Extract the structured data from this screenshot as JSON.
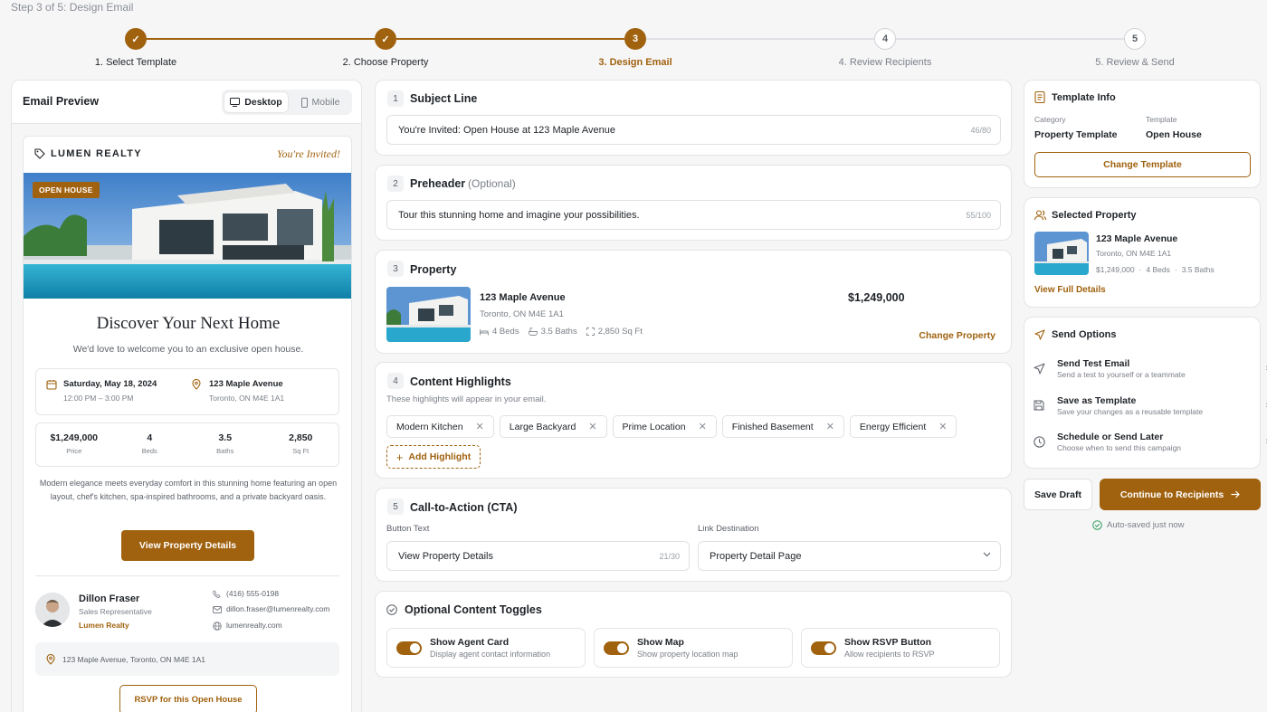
{
  "header": {
    "step_label": "Step 3 of 5: Design Email"
  },
  "stepper": [
    {
      "num": "1",
      "label": "1. Select Template",
      "state": "done"
    },
    {
      "num": "2",
      "label": "2. Choose Property",
      "state": "done"
    },
    {
      "num": "3",
      "label": "3. Design Email",
      "state": "current"
    },
    {
      "num": "4",
      "label": "4. Review Recipients",
      "state": "todo"
    },
    {
      "num": "5",
      "label": "5. Review & Send",
      "state": "todo"
    }
  ],
  "preview": {
    "title": "Email Preview",
    "desktop": "Desktop",
    "mobile": "Mobile",
    "brand": "LUMEN REALTY",
    "invited": "You're Invited!",
    "badge": "OPEN HOUSE",
    "headline": "Discover Your Next Home",
    "subhead": "We'd love to welcome you to an exclusive open house.",
    "date": "Saturday, May 18, 2024",
    "time": "12:00 PM – 3:00 PM",
    "address": "123 Maple Avenue",
    "city": "Toronto, ON M4E 1A1",
    "stats": [
      {
        "value": "$1,249,000",
        "label": "Price"
      },
      {
        "value": "4",
        "label": "Beds"
      },
      {
        "value": "3.5",
        "label": "Baths"
      },
      {
        "value": "2,850",
        "label": "Sq Ft"
      }
    ],
    "description": "Modern elegance meets everyday comfort in this stunning home featuring an open layout, chef's kitchen, spa-inspired bathrooms, and a private backyard oasis.",
    "cta": "View Property Details",
    "agent": {
      "name": "Dillon Fraser",
      "role": "Sales Representative",
      "company": "Lumen Realty",
      "phone": "(416) 555-0198",
      "email": "dillon.fraser@lumenrealty.com",
      "web": "lumenrealty.com"
    },
    "map_address": "123 Maple Avenue, Toronto, ON M4E 1A1",
    "rsvp": "RSVP for this Open House"
  },
  "editor": {
    "subject": {
      "num": "1",
      "title": "Subject Line",
      "value": "You're Invited: Open House at 123 Maple Avenue",
      "count": "46/80"
    },
    "preheader": {
      "num": "2",
      "title": "Preheader",
      "optional": "(Optional)",
      "value": "Tour this stunning home and imagine your possibilities.",
      "count": "55/100"
    },
    "property": {
      "num": "3",
      "title": "Property",
      "name": "123 Maple Avenue",
      "city": "Toronto, ON M4E 1A1",
      "beds": "4 Beds",
      "baths": "3.5 Baths",
      "sqft": "2,850 Sq Ft",
      "price": "$1,249,000",
      "change": "Change Property"
    },
    "highlights": {
      "num": "4",
      "title": "Content Highlights",
      "hint": "These highlights will appear in your email.",
      "items": [
        "Modern Kitchen",
        "Large Backyard",
        "Prime Location",
        "Finished Basement",
        "Energy Efficient"
      ],
      "add": "Add Highlight"
    },
    "cta": {
      "num": "5",
      "title": "Call-to-Action (CTA)",
      "button_label": "Button Text",
      "button_value": "View Property Details",
      "count": "21/30",
      "link_label": "Link Destination",
      "link_value": "Property Detail Page"
    },
    "toggles": {
      "title": "Optional Content Toggles",
      "items": [
        {
          "title": "Show Agent Card",
          "sub": "Display agent contact information",
          "on": true
        },
        {
          "title": "Show Map",
          "sub": "Show property location map",
          "on": true
        },
        {
          "title": "Show RSVP Button",
          "sub": "Allow recipients to RSVP",
          "on": true
        }
      ]
    }
  },
  "sidebar": {
    "template": {
      "title": "Template Info",
      "cat_label": "Category",
      "cat_value": "Property Template",
      "tpl_label": "Template",
      "tpl_value": "Open House",
      "change": "Change Template"
    },
    "property": {
      "title": "Selected Property",
      "name": "123 Maple Avenue",
      "city": "Toronto, ON M4E 1A1",
      "price": "$1,249,000",
      "beds": "4 Beds",
      "baths": "3.5 Baths",
      "link": "View Full Details"
    },
    "send": {
      "title": "Send Options",
      "items": [
        {
          "title": "Send Test Email",
          "sub": "Send a test to yourself or a teammate"
        },
        {
          "title": "Save as Template",
          "sub": "Save your changes as a reusable template"
        },
        {
          "title": "Schedule or Send Later",
          "sub": "Choose when to send this campaign"
        }
      ]
    },
    "save_draft": "Save Draft",
    "continue": "Continue to Recipients",
    "autosave": "Auto-saved just now"
  },
  "colors": {
    "accent": "#a0620f",
    "border": "#e3e5e8"
  }
}
